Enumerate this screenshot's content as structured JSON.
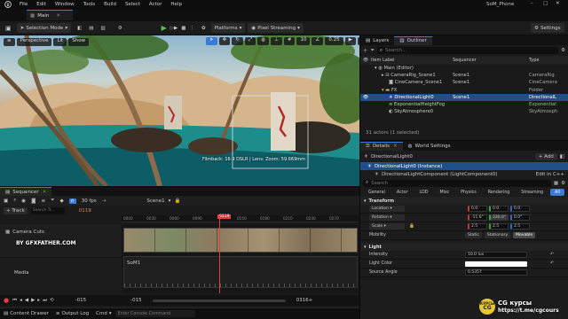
{
  "titlebar": {
    "menu": [
      "File",
      "Edit",
      "Window",
      "Tools",
      "Build",
      "Select",
      "Actor",
      "Help"
    ],
    "project": "SoM_Phone"
  },
  "tabs": {
    "level": "Main"
  },
  "toolbar": {
    "save_icon": "save-icon",
    "selection_mode": "Selection Mode",
    "platforms": "Platforms",
    "streaming": "Pixel Streaming",
    "settings": "Settings"
  },
  "viewport": {
    "perspective": "Perspective",
    "lit": "Lit",
    "show": "Show",
    "fov_value": "10",
    "grid_value": "0.25",
    "cam_value": "4",
    "overlay_text": "Filmback: 16:9 DSLR | Lens: Zoom: 59.669mm"
  },
  "outliner": {
    "tab_layers": "Layers",
    "tab_outliner": "Outliner",
    "search_placeholder": "Search...",
    "col_label": "Item Label",
    "col_sequencer": "Sequencer",
    "col_type": "Type",
    "rows": [
      {
        "label": "Main (Editor)",
        "seq": "",
        "type": ""
      },
      {
        "label": "CameraRig_Scene1",
        "seq": "Scene1",
        "type": "CameraRig"
      },
      {
        "label": "CineCamera_Scene1",
        "seq": "Scene1",
        "type": "CineCamera"
      },
      {
        "label": "FX",
        "seq": "",
        "type": "Folder"
      },
      {
        "label": "DirectionalLight0",
        "seq": "Scene1",
        "type": "DirectionalL"
      },
      {
        "label": "ExponentialHeightFog",
        "seq": "",
        "type": "Exponential"
      },
      {
        "label": "SkyAtmosphere0",
        "seq": "",
        "type": "SkyAtmosph"
      }
    ],
    "status": "31 actors (1 selected)"
  },
  "details": {
    "tab_details": "Details",
    "tab_world": "World Settings",
    "actor_name": "DirectionalLight0",
    "add_button": "+ Add",
    "instance_label": "DirectionalLight0 (Instance)",
    "component_label": "DirectionalLightComponent (LightComponent0)",
    "edit_cpp": "Edit in C++",
    "search_placeholder": "Search",
    "categories": [
      "General",
      "Actor",
      "LOD",
      "Misc",
      "Physics",
      "Rendering",
      "Streaming",
      "All"
    ],
    "transform_header": "Transform",
    "location_label": "Location",
    "location": [
      "0.0",
      "0.0",
      "0.0"
    ],
    "rotation_label": "Rotation",
    "rotation": [
      "-11.6°",
      "330.0°",
      "0.0°"
    ],
    "scale_label": "Scale",
    "scale": [
      "2.5",
      "2.5",
      "2.5"
    ],
    "mobility_label": "Mobility",
    "mobility": [
      "Static",
      "Stationary",
      "Movable"
    ],
    "light_header": "Light",
    "intensity_label": "Intensity",
    "intensity_value": "10.0 lux",
    "light_color_label": "Light Color",
    "source_angle_label": "Source Angle",
    "source_angle_value": "0.5357"
  },
  "sequencer": {
    "tab": "Sequencer",
    "fps": "30 fps",
    "sequence_name": "Scene1",
    "track_button": "+ Track",
    "search_placeholder": "Search Tr...",
    "frame_current": "0119",
    "timecode": "0119",
    "ticks": [
      "0000",
      "0015",
      "0030",
      "0045",
      "0060",
      "0075",
      "0090",
      "0105",
      "0120",
      "0135",
      "0150",
      "0165",
      "0180",
      "0195",
      "0210",
      "0225",
      "0240",
      "0255",
      "0270",
      "0285",
      "0300"
    ],
    "tracks": [
      {
        "label": "Camera Cuts"
      },
      {
        "label": "Media"
      }
    ],
    "watermark_text": "BY GFXFATHER.COM",
    "section_name": "SoM1",
    "range_start": "-015",
    "range_mid": "-015",
    "range_end": "0316+"
  },
  "bottombar": {
    "content_drawer": "Content Drawer",
    "output_log": "Output Log",
    "cmd": "Cmd",
    "console_placeholder": "Enter Console Command"
  },
  "badge": {
    "line1": "CG курсы",
    "line2": "https://t.me/cgcours",
    "logo_text": "КУРСЫ CG"
  },
  "colors": {
    "accent": "#3a7bd5",
    "selection": "#1f4f8a",
    "play": "#4cc34c",
    "playhead": "#e04040"
  }
}
